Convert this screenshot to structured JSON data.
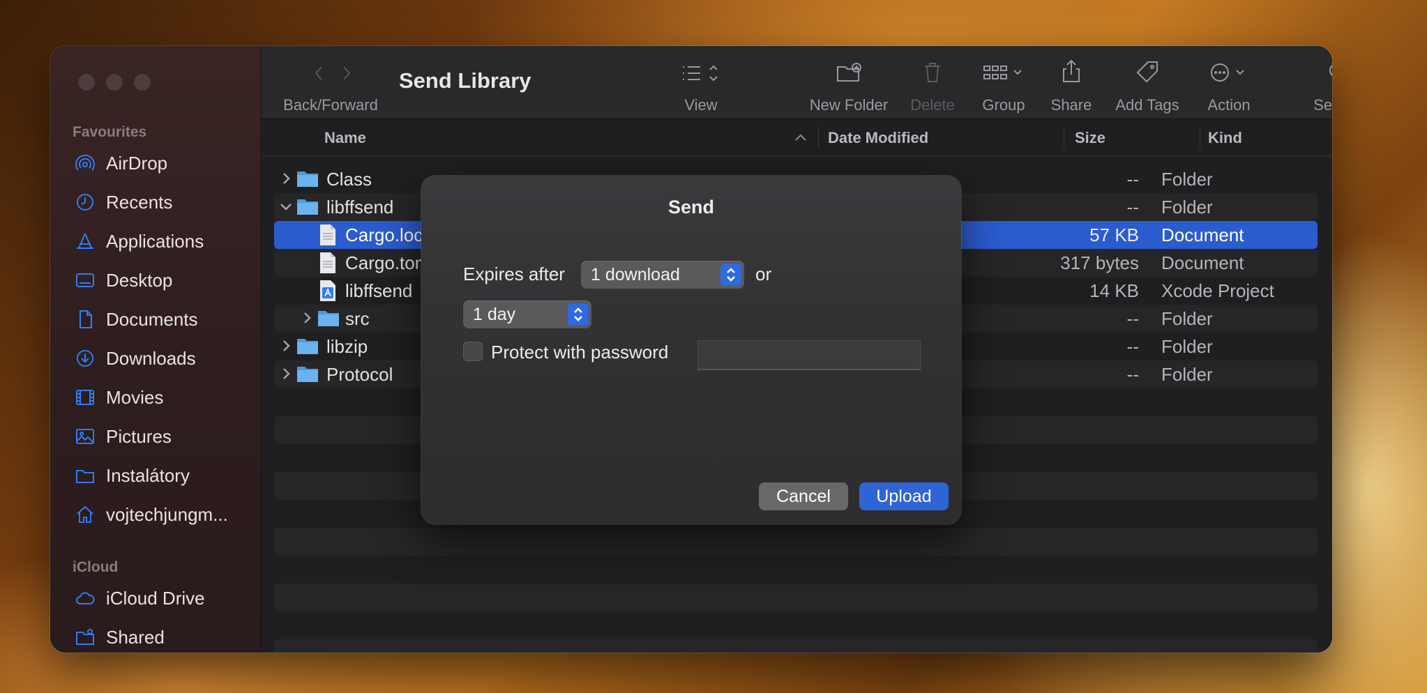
{
  "window": {
    "title": "Send Library"
  },
  "sidebar": {
    "favourites_heading": "Favourites",
    "favourites": [
      {
        "label": "AirDrop",
        "icon": "airdrop-icon"
      },
      {
        "label": "Recents",
        "icon": "clock-icon"
      },
      {
        "label": "Applications",
        "icon": "applications-icon"
      },
      {
        "label": "Desktop",
        "icon": "desktop-icon"
      },
      {
        "label": "Documents",
        "icon": "document-icon"
      },
      {
        "label": "Downloads",
        "icon": "download-icon"
      },
      {
        "label": "Movies",
        "icon": "film-icon"
      },
      {
        "label": "Pictures",
        "icon": "photo-icon"
      },
      {
        "label": "Instalátory",
        "icon": "folder-icon"
      },
      {
        "label": "vojtechjungm...",
        "icon": "home-icon"
      }
    ],
    "icloud_heading": "iCloud",
    "icloud": [
      {
        "label": "iCloud Drive",
        "icon": "cloud-icon"
      },
      {
        "label": "Shared",
        "icon": "shared-folder-icon"
      }
    ]
  },
  "toolbar": {
    "back_forward": "Back/Forward",
    "view": "View",
    "new_folder": "New Folder",
    "delete": "Delete",
    "group": "Group",
    "share": "Share",
    "add_tags": "Add Tags",
    "action": "Action",
    "search": "Search"
  },
  "columns": {
    "name": "Name",
    "date_modified": "Date Modified",
    "size": "Size",
    "kind": "Kind"
  },
  "files": [
    {
      "name": "Class",
      "size": "--",
      "kind": "Folder"
    },
    {
      "name": "libffsend",
      "size": "--",
      "kind": "Folder"
    },
    {
      "name": "Cargo.lock",
      "size": "57 KB",
      "kind": "Document"
    },
    {
      "name": "Cargo.toml",
      "size": "317 bytes",
      "kind": "Document"
    },
    {
      "name": "libffsend",
      "size": "14 KB",
      "kind": "Xcode Project"
    },
    {
      "name": "src",
      "size": "--",
      "kind": "Folder"
    },
    {
      "name": "libzip",
      "size": "--",
      "kind": "Folder"
    },
    {
      "name": "Protocol",
      "size": "--",
      "kind": "Folder"
    }
  ],
  "dialog": {
    "title": "Send",
    "expires_label": "Expires after",
    "downloads_value": "1 download",
    "or_label": "or",
    "time_value": "1 day",
    "password_label": "Protect with password",
    "password_value": "",
    "cancel": "Cancel",
    "upload": "Upload"
  },
  "colors": {
    "accent": "#2f64d6",
    "selection": "#2b5ccf"
  }
}
